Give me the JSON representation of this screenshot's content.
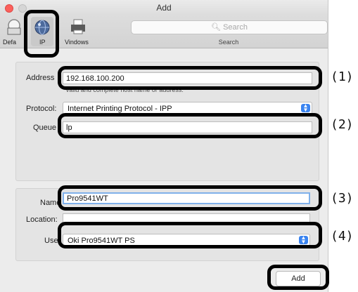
{
  "window": {
    "title": "Add"
  },
  "toolbar": {
    "default_label": "Defa",
    "ip_label": "IP",
    "windows_label": "Vindows",
    "search_placeholder": "Search",
    "search_caption": "Search"
  },
  "form": {
    "address": {
      "label": "Address",
      "value": "192.168.100.200",
      "hint": "Valid and complete host name or address."
    },
    "protocol": {
      "label": "Protocol:",
      "value": "Internet Printing Protocol - IPP"
    },
    "queue": {
      "label": "Queue",
      "value": "lp"
    },
    "name": {
      "label": "Name",
      "value": "Pro9541WT"
    },
    "location": {
      "label": "Location:",
      "value": ""
    },
    "use": {
      "label": "Use",
      "value": "Oki Pro9541WT PS"
    }
  },
  "buttons": {
    "add_label": "Add"
  },
  "callouts": [
    "(1)",
    "(2)",
    "(3)",
    "(4)"
  ],
  "colors": {
    "accent": "#3a84f0",
    "focus_ring": "#7fb0ea",
    "highlight": "#000000"
  },
  "icons": [
    "close-dot",
    "minimize-dot",
    "default-printer-icon",
    "ip-globe-icon",
    "windows-printer-icon",
    "search-icon",
    "select-arrows-icon"
  ]
}
